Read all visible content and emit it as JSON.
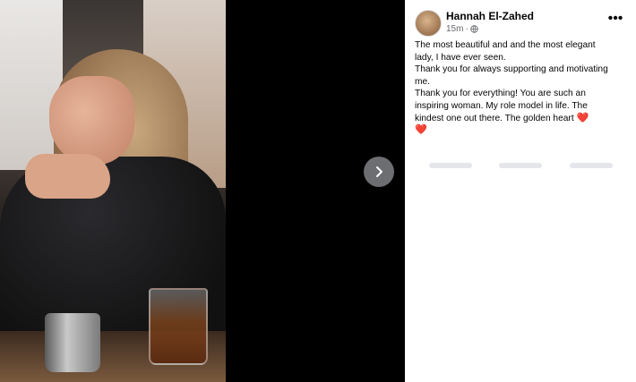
{
  "post": {
    "author": "Hannah El-Zahed",
    "time": "15m",
    "separator": "·",
    "privacy_icon": "globe-icon",
    "more_icon": "more-options-icon",
    "lines": [
      "The most beautiful and and the most elegant lady, I have ever seen.",
      "Thank you for always supporting and motivating me.",
      "Thank you for everything! You are such an inspiring woman. My role model in life. The kindest one out there. The golden heart"
    ],
    "heart_emoji": "❤️",
    "trailing_heart": "❤️"
  },
  "viewer": {
    "next_icon": "chevron-right-icon"
  },
  "colors": {
    "viewer_background": "#000000",
    "text": "#050505",
    "meta": "#65676b",
    "heart": "#e41e3f",
    "skeleton": "#e4e6eb"
  }
}
